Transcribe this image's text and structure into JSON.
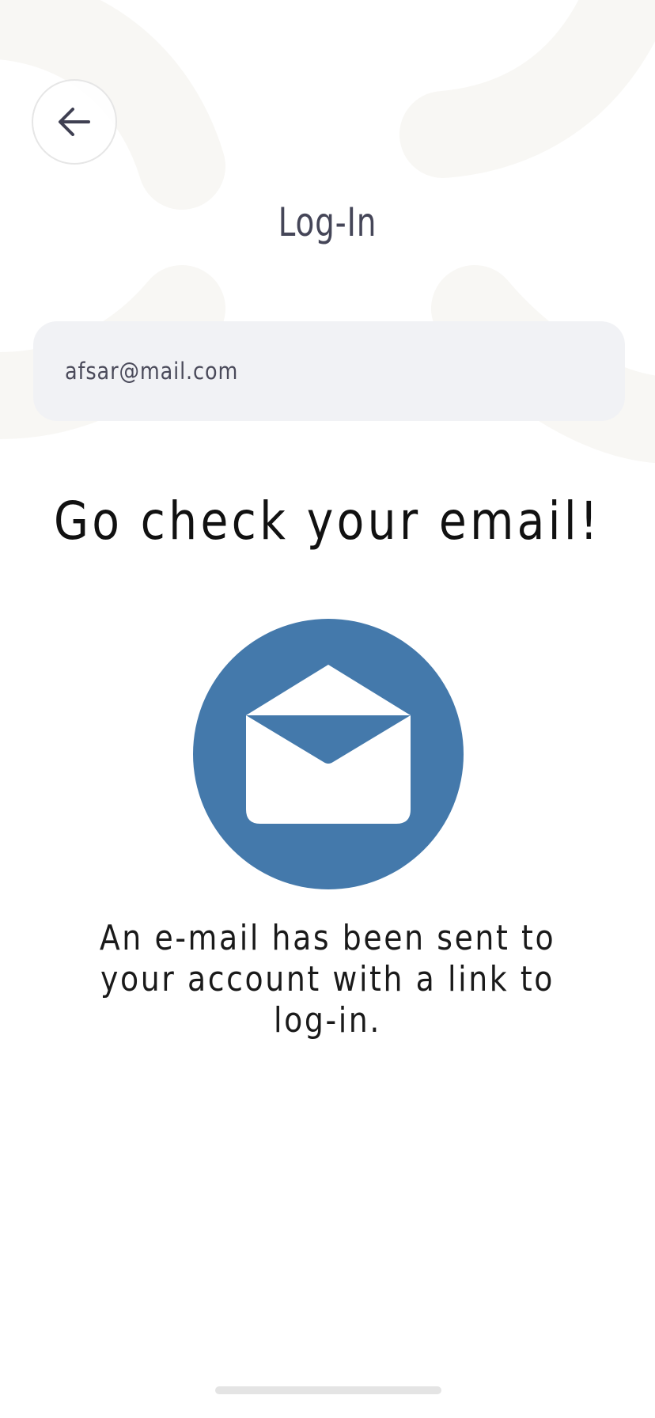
{
  "header": {
    "back_icon": "arrow-left-icon",
    "title": "Log-In"
  },
  "email_field": {
    "value": "afsar@mail.com"
  },
  "confirmation": {
    "headline": "Go check your email!",
    "illustration_icon": "open-envelope-icon",
    "message_lines": [
      "An e-mail has been sent to",
      "your account with a link to",
      "log-in."
    ]
  },
  "colors": {
    "accent": "#4479ab",
    "title_text": "#454658",
    "field_background": "#f1f2f5",
    "background_shapes": "#f8f7f4"
  }
}
